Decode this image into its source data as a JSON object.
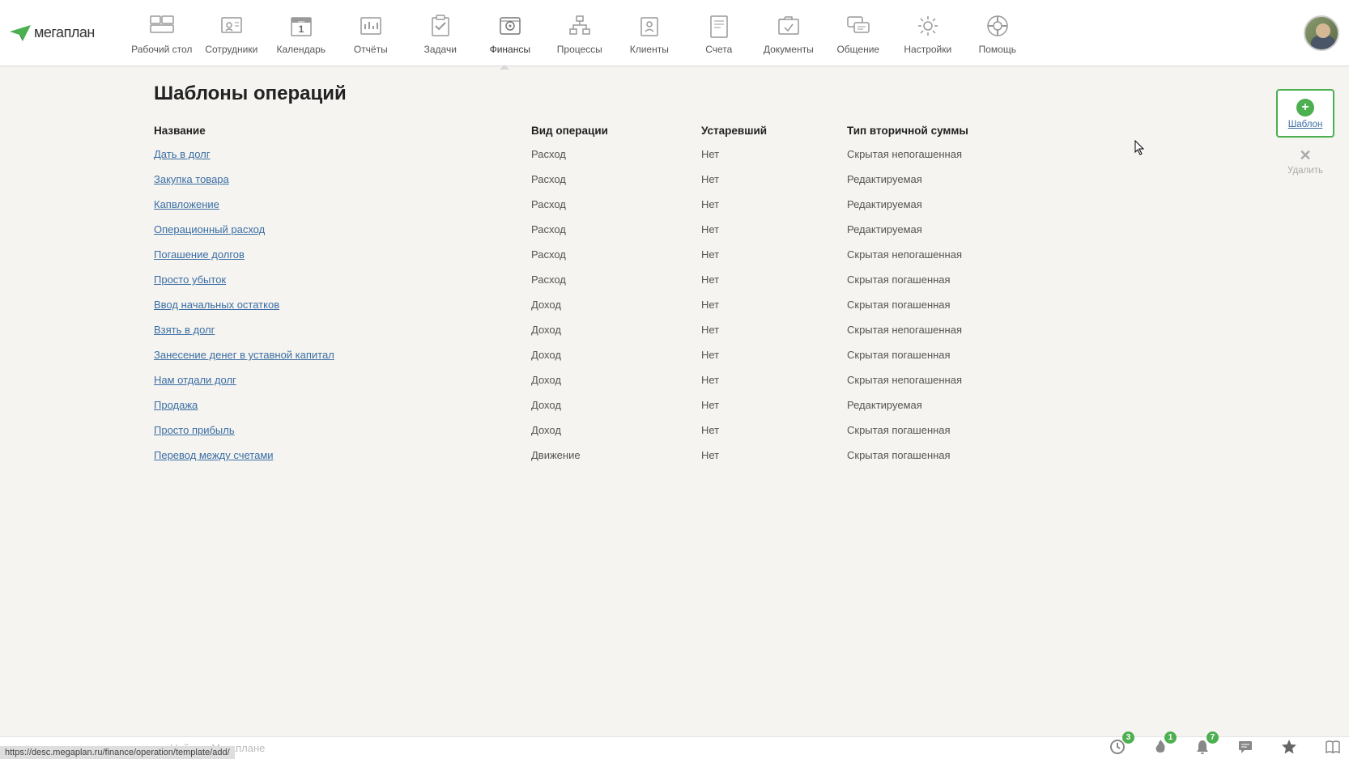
{
  "app_name": "мегаплан",
  "nav": [
    {
      "id": "desktop",
      "label": "Рабочий стол"
    },
    {
      "id": "employees",
      "label": "Сотрудники"
    },
    {
      "id": "calendar",
      "label": "Календарь",
      "day": "1",
      "month": "апр"
    },
    {
      "id": "reports",
      "label": "Отчёты"
    },
    {
      "id": "tasks",
      "label": "Задачи"
    },
    {
      "id": "finance",
      "label": "Финансы"
    },
    {
      "id": "processes",
      "label": "Процессы"
    },
    {
      "id": "clients",
      "label": "Клиенты"
    },
    {
      "id": "accounts",
      "label": "Счета"
    },
    {
      "id": "documents",
      "label": "Документы"
    },
    {
      "id": "chat",
      "label": "Общение"
    },
    {
      "id": "settings",
      "label": "Настройки"
    },
    {
      "id": "help",
      "label": "Помощь"
    }
  ],
  "page_title": "Шаблоны операций",
  "columns": {
    "name": "Название",
    "type": "Вид операции",
    "deprecated": "Устаревший",
    "secondary": "Тип вторичной суммы"
  },
  "rows": [
    {
      "name": "Дать в долг",
      "type": "Расход",
      "deprecated": "Нет",
      "secondary": "Скрытая непогашенная"
    },
    {
      "name": "Закупка товара",
      "type": "Расход",
      "deprecated": "Нет",
      "secondary": "Редактируемая"
    },
    {
      "name": "Капвложение",
      "type": "Расход",
      "deprecated": "Нет",
      "secondary": "Редактируемая"
    },
    {
      "name": "Операционный расход",
      "type": "Расход",
      "deprecated": "Нет",
      "secondary": "Редактируемая"
    },
    {
      "name": "Погашение долгов",
      "type": "Расход",
      "deprecated": "Нет",
      "secondary": "Скрытая непогашенная"
    },
    {
      "name": "Просто убыток",
      "type": "Расход",
      "deprecated": "Нет",
      "secondary": "Скрытая погашенная"
    },
    {
      "name": "Ввод начальных остатков",
      "type": "Доход",
      "deprecated": "Нет",
      "secondary": "Скрытая погашенная"
    },
    {
      "name": "Взять в долг",
      "type": "Доход",
      "deprecated": "Нет",
      "secondary": "Скрытая непогашенная"
    },
    {
      "name": "Занесение денег в уставной капитал",
      "type": "Доход",
      "deprecated": "Нет",
      "secondary": "Скрытая погашенная"
    },
    {
      "name": "Нам отдали долг",
      "type": "Доход",
      "deprecated": "Нет",
      "secondary": "Скрытая непогашенная"
    },
    {
      "name": "Продажа",
      "type": "Доход",
      "deprecated": "Нет",
      "secondary": "Редактируемая"
    },
    {
      "name": "Просто прибыль",
      "type": "Доход",
      "deprecated": "Нет",
      "secondary": "Скрытая погашенная"
    },
    {
      "name": "Перевод между счетами",
      "type": "Движение",
      "deprecated": "Нет",
      "secondary": "Скрытая погашенная"
    }
  ],
  "actions": {
    "add_label": "Шаблон",
    "delete_label": "Удалить"
  },
  "search_placeholder": "Найти в Мегаплане",
  "status_url": "https://desc.megaplan.ru/finance/operation/template/add/",
  "notifications": {
    "clock": "3",
    "fire": "1",
    "bell": "7"
  }
}
